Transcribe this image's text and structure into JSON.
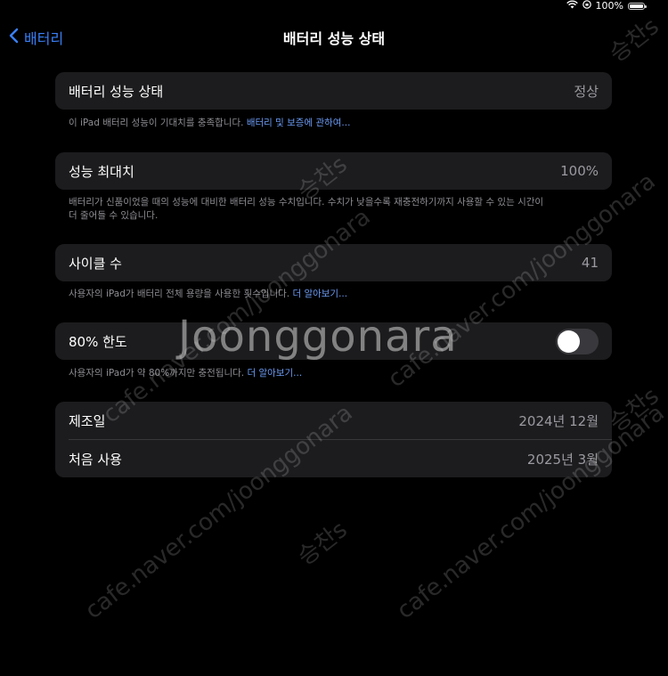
{
  "status_bar": {
    "wifi_icon": "wifi-icon",
    "battery_percent": "100%",
    "battery_level": 1.0
  },
  "nav": {
    "back_label": "배터리",
    "title": "배터리 성능 상태"
  },
  "health": {
    "label": "배터리 성능 상태",
    "value": "정상",
    "note": "이 iPad 배터리 성능이 기대치를 충족합니다.",
    "link": "배터리 및 보증에 관하여..."
  },
  "capacity": {
    "label": "성능 최대치",
    "value": "100%",
    "note_line1": "배터리가 신품이었을 때의 성능에 대비한 배터리 성능 수치입니다. 수치가 낮을수록 재충전하기까지 사용할 수 있는 시간이",
    "note_line2": "더 줄어들 수 있습니다."
  },
  "cycles": {
    "label": "사이클 수",
    "value": "41",
    "note": "사용자의 iPad가 배터리 전체 용량을 사용한 횟수입니다.",
    "link": "더 알아보기..."
  },
  "limit": {
    "label": "80% 한도",
    "toggle_on": false,
    "note": "사용자의 iPad가 약 80%까지만 충전됩니다.",
    "link": "더 알아보기..."
  },
  "dates": {
    "manufacture_label": "제조일",
    "manufacture_value": "2024년 12월",
    "first_use_label": "처음 사용",
    "first_use_value": "2025년 3월"
  },
  "watermark": {
    "brand": "Joonggonara",
    "url": "cafe.naver.com/joonggonara",
    "seller": "승찬s"
  }
}
